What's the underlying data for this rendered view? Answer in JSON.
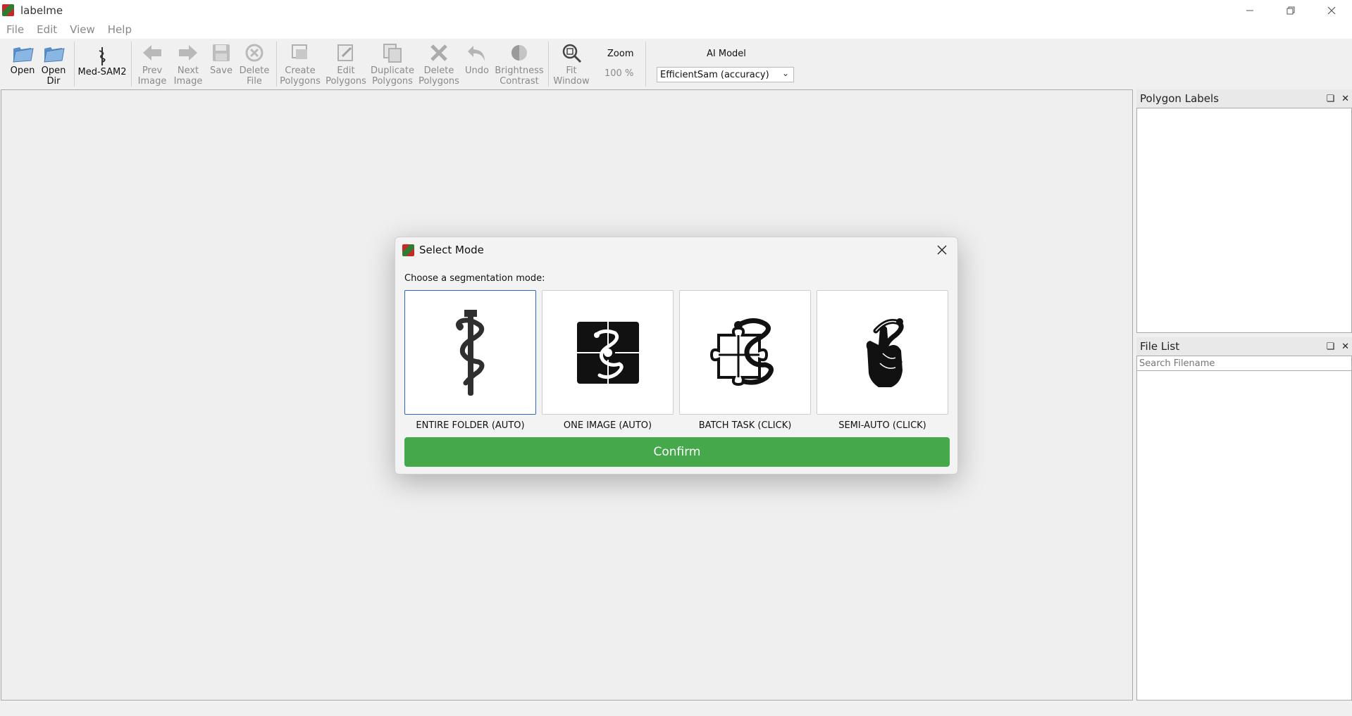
{
  "window": {
    "title": "labelme",
    "minimize_icon": "minimize-icon",
    "maximize_icon": "restore-icon",
    "close_icon": "close-icon"
  },
  "menu": {
    "items": [
      "File",
      "Edit",
      "View",
      "Help"
    ]
  },
  "toolbar": {
    "open": "Open",
    "open_dir": [
      "Open",
      "Dir"
    ],
    "med_sam2": "Med-SAM2",
    "prev_image": [
      "Prev",
      "Image"
    ],
    "next_image": [
      "Next",
      "Image"
    ],
    "save": "Save",
    "delete_file": [
      "Delete",
      "File"
    ],
    "create_polygons": [
      "Create",
      "Polygons"
    ],
    "edit_polygons": [
      "Edit",
      "Polygons"
    ],
    "duplicate_polygons": [
      "Duplicate",
      "Polygons"
    ],
    "delete_polygons": [
      "Delete",
      "Polygons"
    ],
    "undo": "Undo",
    "brightness_contrast": [
      "Brightness",
      "Contrast"
    ],
    "fit_window": [
      "Fit",
      "Window"
    ],
    "zoom_label": "Zoom",
    "zoom_value": "100 %",
    "ai_model_label": "AI Model",
    "ai_model_selected": "EfficientSam (accuracy)"
  },
  "docks": {
    "polygon_labels": {
      "title": "Polygon Labels"
    },
    "file_list": {
      "title": "File List",
      "search_placeholder": "Search Filename"
    }
  },
  "dialog": {
    "title": "Select Mode",
    "prompt": "Choose a segmentation mode:",
    "modes": [
      {
        "label": "ENTIRE FOLDER (AUTO)",
        "icon": "rod-of-asclepius-icon",
        "selected": true
      },
      {
        "label": "ONE IMAGE (AUTO)",
        "icon": "snake-puzzle-square-icon",
        "selected": false
      },
      {
        "label": "BATCH TASK (CLICK)",
        "icon": "snake-puzzle-pieces-icon",
        "selected": false
      },
      {
        "label": "SEMI-AUTO (CLICK)",
        "icon": "snake-hand-icon",
        "selected": false
      }
    ],
    "confirm_label": "Confirm"
  },
  "colors": {
    "confirm": "#45a84a",
    "selected_border": "#2a68c4",
    "icon_dark": "#2f2f2f"
  }
}
